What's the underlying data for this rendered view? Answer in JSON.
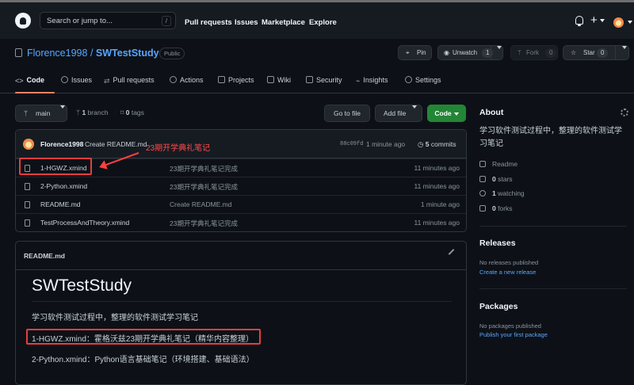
{
  "header": {
    "search_placeholder": "Search or jump to...",
    "slash": "/",
    "nav": [
      "Pull requests",
      "Issues",
      "Marketplace",
      "Explore"
    ],
    "plus": "+",
    "icons": [
      "github-logo-icon",
      "bell-icon",
      "avatar-icon"
    ]
  },
  "repo": {
    "owner": "Florence1998",
    "separator": "/",
    "name": "SWTestStudy",
    "visibility": "Public",
    "pin": "Pin",
    "unwatch": "Unwatch",
    "watch_count": "1",
    "fork": "Fork",
    "fork_count": "0",
    "star": "Star",
    "star_count": "0"
  },
  "tabs": [
    "Code",
    "Issues",
    "Pull requests",
    "Actions",
    "Projects",
    "Wiki",
    "Security",
    "Insights",
    "Settings"
  ],
  "controls": {
    "branch": "main",
    "branch_count": "1",
    "branch_label": "branch",
    "tag_count": "0",
    "tag_label": "tags",
    "go_to_file": "Go to file",
    "add_file": "Add file",
    "code": "Code"
  },
  "commit": {
    "user": "Florence1998",
    "message": "Create README.md",
    "hash": "88c09fd",
    "time": "1 minute ago",
    "count": "5",
    "count_label": "commits"
  },
  "files": [
    {
      "name": "1-HGWZ.xmind",
      "message": "23期开学典礼笔记完成",
      "time": "11 minutes ago"
    },
    {
      "name": "2-Python.xmind",
      "message": "23期开学典礼笔记完成",
      "time": "11 minutes ago"
    },
    {
      "name": "README.md",
      "message": "Create README.md",
      "time": "1 minute ago"
    },
    {
      "name": "TestProcessAndTheory.xmind",
      "message": "23期开学典礼笔记完成",
      "time": "11 minutes ago"
    }
  ],
  "annotation": "23期开学典礼笔记",
  "readme": {
    "filename": "README.md",
    "title": "SWTestStudy",
    "p1": "学习软件测试过程中，整理的软件测试学习笔记",
    "p2": "1-HGWZ.xmind：霍格沃兹23期开学典礼笔记（精华内容整理）",
    "p3": "2-Python.xmind：Python语言基础笔记（环境搭建、基础语法）"
  },
  "about": {
    "title": "About",
    "description": "学习软件测试过程中，整理的软件测试学习笔记",
    "readme": "Readme",
    "stars_count": "0",
    "stars_label": "stars",
    "watching_count": "1",
    "watching_label": "watching",
    "forks_count": "0",
    "forks_label": "forks"
  },
  "releases": {
    "title": "Releases",
    "empty": "No releases published",
    "link": "Create a new release"
  },
  "packages": {
    "title": "Packages",
    "empty": "No packages published",
    "link": "Publish your first package"
  },
  "colors": {
    "background": "#0d1117",
    "link": "#58a6ff",
    "green_button": "#238636",
    "annotation_red": "#ff4b4b",
    "active_tab": "#f78166"
  }
}
